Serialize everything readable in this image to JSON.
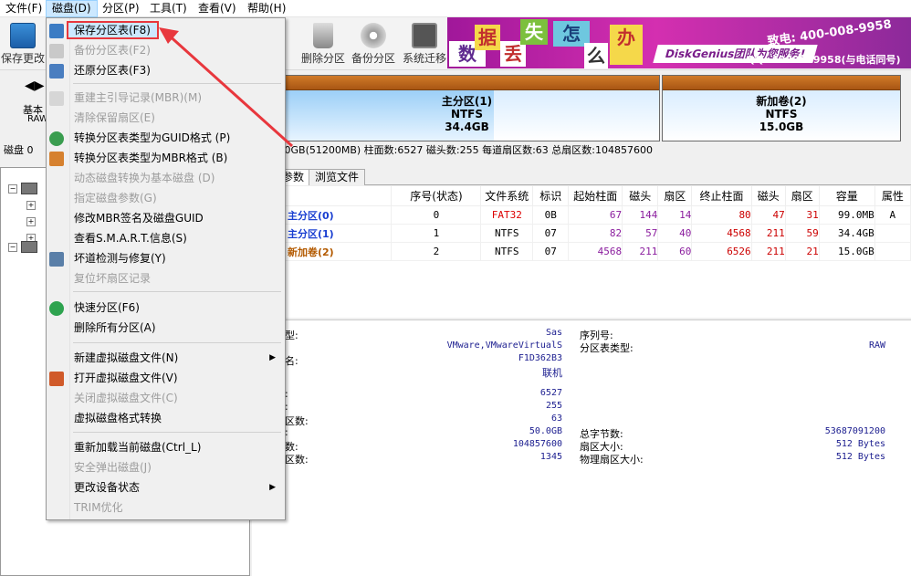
{
  "menubar": [
    "文件(F)",
    "磁盘(D)",
    "分区(P)",
    "工具(T)",
    "查看(V)",
    "帮助(H)"
  ],
  "toolbar": {
    "save": "保存更改",
    "delete": "删除分区",
    "backup": "备份分区",
    "migrate": "系统迁移",
    "hidden_tail": "区"
  },
  "banner": {
    "chars": [
      "数",
      "据",
      "丢",
      "失",
      "怎",
      "么",
      "办"
    ],
    "slogan": "DiskGenius团队为您服务!",
    "phone": "致电: 400-008-9958",
    "qq": "QQ: 4000089958(与电话同号)"
  },
  "left_panel": {
    "basic": "基本",
    "raw": "RAW",
    "disk_prefix": "磁盘 0 "
  },
  "partitions": [
    {
      "name": "主分区(1)",
      "fs": "NTFS",
      "size": "34.4GB"
    },
    {
      "name": "新加卷(2)",
      "fs": "NTFS",
      "size": "15.0GB"
    }
  ],
  "diskline": ".0GB(51200MB)  柱面数:6527  磁头数:255  每道扇区数:63  总扇区数:104857600",
  "tabs": [
    "参数",
    "浏览文件"
  ],
  "table": {
    "headers": [
      "序号(状态)",
      "文件系统",
      "标识",
      "起始柱面",
      "磁头",
      "扇区",
      "终止柱面",
      "磁头",
      "扇区",
      "容量",
      "属性"
    ],
    "rows": [
      {
        "name": "主分区(0)",
        "cells": [
          "0",
          "FAT32",
          "0B",
          "67",
          "144",
          "14",
          "80",
          "47",
          "31",
          "99.0MB",
          "A"
        ]
      },
      {
        "name": "主分区(1)",
        "cells": [
          "1",
          "NTFS",
          "07",
          "82",
          "57",
          "40",
          "4568",
          "211",
          "59",
          "34.4GB",
          ""
        ]
      },
      {
        "name": "新加卷(2)",
        "cells": [
          "2",
          "NTFS",
          "07",
          "4568",
          "211",
          "60",
          "6526",
          "211",
          "21",
          "15.0GB",
          ""
        ]
      }
    ]
  },
  "info": {
    "l1": [
      "型:",
      "名:"
    ],
    "v1": [
      "Sas",
      "VMware,VMwareVirtualS",
      "F1D362B3",
      "联机"
    ],
    "r1": [
      "序列号:",
      "分区表类型:"
    ],
    "rv1": [
      "",
      "RAW"
    ],
    "l2": [
      ":",
      ":",
      "区数:",
      ":",
      "数:",
      "区数:"
    ],
    "v2": [
      "6527",
      "255",
      "63",
      "50.0GB",
      "104857600",
      "1345"
    ],
    "r2": [
      "总字节数:",
      "扇区大小:",
      "物理扇区大小:"
    ],
    "rv2": [
      "53687091200",
      "512 Bytes",
      "512 Bytes"
    ]
  },
  "menu": {
    "items": [
      {
        "label": "保存分区表(F8)",
        "enabled": true
      },
      {
        "label": "备份分区表(F2)",
        "enabled": false
      },
      {
        "label": "还原分区表(F3)",
        "enabled": true
      },
      {
        "label": "重建主引导记录(MBR)(M)",
        "enabled": false
      },
      {
        "label": "清除保留扇区(E)",
        "enabled": false
      },
      {
        "label": "转换分区表类型为GUID格式 (P)",
        "enabled": true
      },
      {
        "label": "转换分区表类型为MBR格式 (B)",
        "enabled": true
      },
      {
        "label": "动态磁盘转换为基本磁盘 (D)",
        "enabled": false
      },
      {
        "label": "指定磁盘参数(G)",
        "enabled": false
      },
      {
        "label": "修改MBR签名及磁盘GUID",
        "enabled": true
      },
      {
        "label": "查看S.M.A.R.T.信息(S)",
        "enabled": true
      },
      {
        "label": "坏道检测与修复(Y)",
        "enabled": true
      },
      {
        "label": "复位坏扇区记录",
        "enabled": false
      },
      {
        "label": "快速分区(F6)",
        "enabled": true
      },
      {
        "label": "删除所有分区(A)",
        "enabled": true
      },
      {
        "label": "新建虚拟磁盘文件(N)",
        "enabled": true
      },
      {
        "label": "打开虚拟磁盘文件(V)",
        "enabled": true
      },
      {
        "label": "关闭虚拟磁盘文件(C)",
        "enabled": false
      },
      {
        "label": "虚拟磁盘格式转换",
        "enabled": true
      },
      {
        "label": "重新加载当前磁盘(Ctrl_L)",
        "enabled": true
      },
      {
        "label": "安全弹出磁盘(J)",
        "enabled": false
      },
      {
        "label": "更改设备状态",
        "enabled": true
      },
      {
        "label": "TRIM优化",
        "enabled": false
      }
    ]
  },
  "colors": {
    "highlight": "#cce8ff",
    "annotation": "#e8373d",
    "partition_header": "#c46a1e"
  }
}
